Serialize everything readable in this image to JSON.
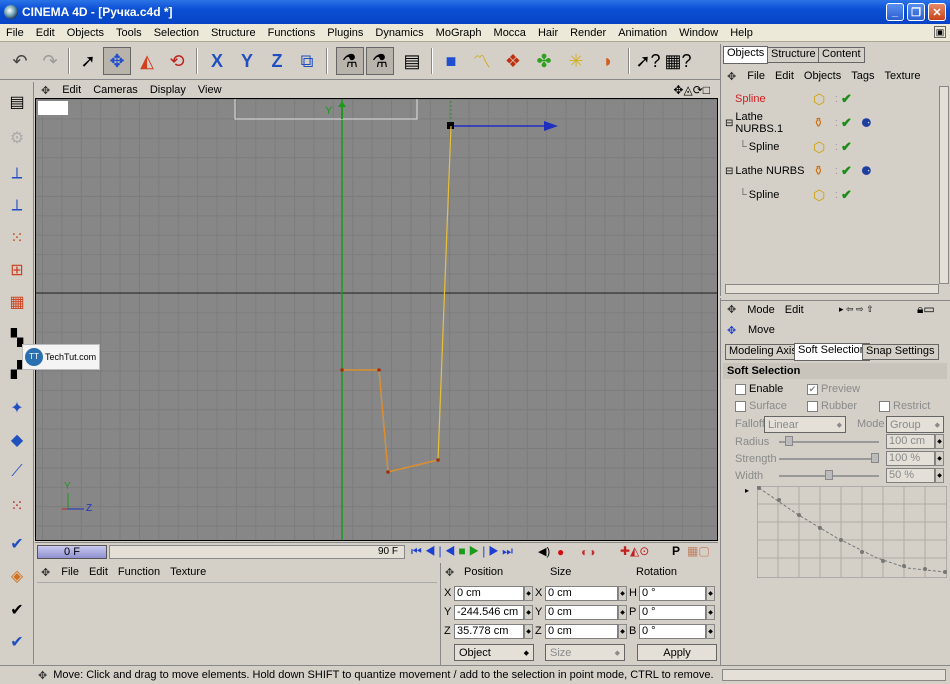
{
  "window": {
    "title": "CINEMA 4D - [Ручка.c4d *]",
    "min": "_",
    "max": "❐",
    "close": "✕"
  },
  "menu": [
    "File",
    "Edit",
    "Objects",
    "Tools",
    "Selection",
    "Structure",
    "Functions",
    "Plugins",
    "Dynamics",
    "MoGraph",
    "Mocca",
    "Hair",
    "Render",
    "Animation",
    "Window",
    "Help"
  ],
  "viewport": {
    "menu": [
      "Edit",
      "Cameras",
      "Display",
      "View"
    ],
    "axis_y": "Y",
    "axis_z": "Z",
    "nav_icons": "✥◬⟳□"
  },
  "watermark": "TechTut.com",
  "timeline": {
    "current_frame": "0 F",
    "end_frame": "90 F"
  },
  "bottom_left_menu": [
    "File",
    "Edit",
    "Function",
    "Texture"
  ],
  "coords": {
    "headers": {
      "position": "Position",
      "size": "Size",
      "rotation": "Rotation"
    },
    "rows": [
      {
        "pl": "X",
        "pv": "0 cm",
        "sl": "X",
        "sv": "0 cm",
        "rl": "H",
        "rv": "0 °"
      },
      {
        "pl": "Y",
        "pv": "-244.546 cm",
        "sl": "Y",
        "sv": "0 cm",
        "rl": "P",
        "rv": "0 °"
      },
      {
        "pl": "Z",
        "pv": "35.778 cm",
        "sl": "Z",
        "sv": "0 cm",
        "rl": "B",
        "rv": "0 °"
      }
    ],
    "mode": "Object",
    "size_mode": "Size",
    "apply": "Apply"
  },
  "status": "Move: Click and drag to move elements. Hold down SHIFT to quantize movement / add to the selection in point mode, CTRL to remove.",
  "objmgr": {
    "tabs": [
      "Objects",
      "Structure",
      "Content"
    ],
    "menu": [
      "File",
      "Edit",
      "Objects",
      "Tags",
      "Texture"
    ],
    "items": [
      {
        "name": "Spline",
        "selected": true,
        "expander": ""
      },
      {
        "name": "Lathe NURBS.1",
        "selected": false,
        "expander": "⊟"
      },
      {
        "name": "Spline",
        "selected": false,
        "expander": ""
      },
      {
        "name": "Lathe NURBS",
        "selected": false,
        "expander": "⊟"
      },
      {
        "name": "Spline",
        "selected": false,
        "expander": ""
      }
    ]
  },
  "attrmgr": {
    "menu": [
      "Mode",
      "Edit"
    ],
    "tool": "Move",
    "tabs": [
      "Modeling Axis",
      "Soft Selection",
      "Snap Settings"
    ],
    "section": "Soft Selection",
    "enable": "Enable",
    "preview": "Preview",
    "surface": "Surface",
    "rubber": "Rubber",
    "restrict": "Restrict",
    "falloff_label": "Falloff",
    "falloff_value": "Linear",
    "mode_label": "Mode",
    "mode_value": "Group",
    "radius_label": "Radius",
    "radius_value": "100 cm",
    "strength_label": "Strength",
    "strength_value": "100 %",
    "width_label": "Width",
    "width_value": "50 %"
  }
}
